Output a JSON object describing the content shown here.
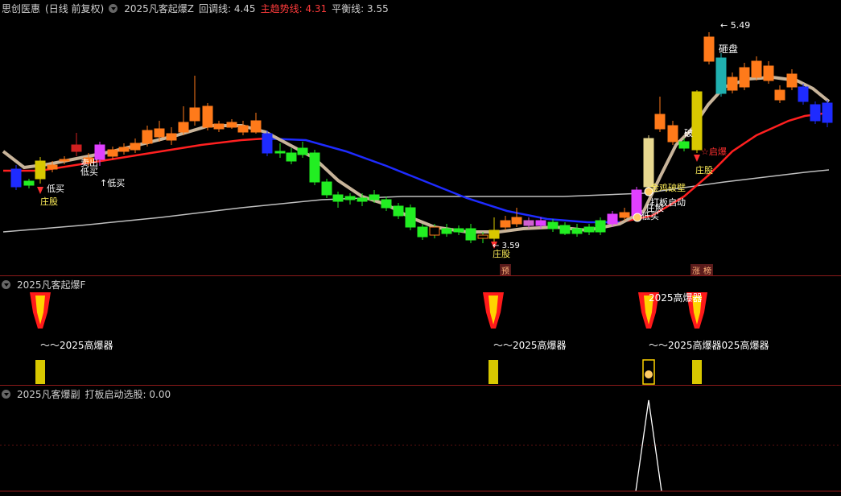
{
  "panel1": {
    "stock_name": "思创医惠",
    "period": "(日线 前复权)",
    "indicator": "2025凡客起爆Z",
    "pullback_label": "回调线:",
    "pullback_value": "4.45",
    "trend_label": "主趋势线:",
    "trend_value": "4.31",
    "balance_label": "平衡线:",
    "balance_value": "3.55",
    "high_price": "5.49",
    "low_price": "3.59"
  },
  "annotations": {
    "zhuanggu": "庄股",
    "dimai": "低买",
    "dimai_arrow": "↑低买",
    "maichu": "卖出",
    "zapan": "砸盘",
    "qibao": "启爆",
    "dabanqidong": "打板启动",
    "jiedi": "金鸡破壁",
    "po": "破",
    "yu": "预",
    "zhangting": "涨",
    "bang": "榜"
  },
  "panel2": {
    "title": "2025凡客起爆F",
    "label": "～～2025高爆器",
    "label_plain": "2025高爆器",
    "label_combo": "～～2025高爆器025高爆器"
  },
  "panel3": {
    "title": "2025凡客爆副",
    "signal_label": "打板启动选股:",
    "signal_value": "0.00"
  },
  "colors": {
    "up": "#ff7a1a",
    "down_green": "#22ee22",
    "down_blue": "#1e2bff",
    "trend_red": "#ff2020",
    "pullback_beige": "#c8b49a",
    "balance_gray": "#bfbfbf",
    "signal_yellow": "#d8c800",
    "signal_magenta": "#e040ff"
  },
  "chart_data": {
    "type": "candlestick",
    "price_high": 5.49,
    "price_low": 3.59,
    "indicator_values": {
      "pullback": 4.45,
      "trend": 4.31,
      "balance": 3.55,
      "signal": 0.0
    }
  }
}
